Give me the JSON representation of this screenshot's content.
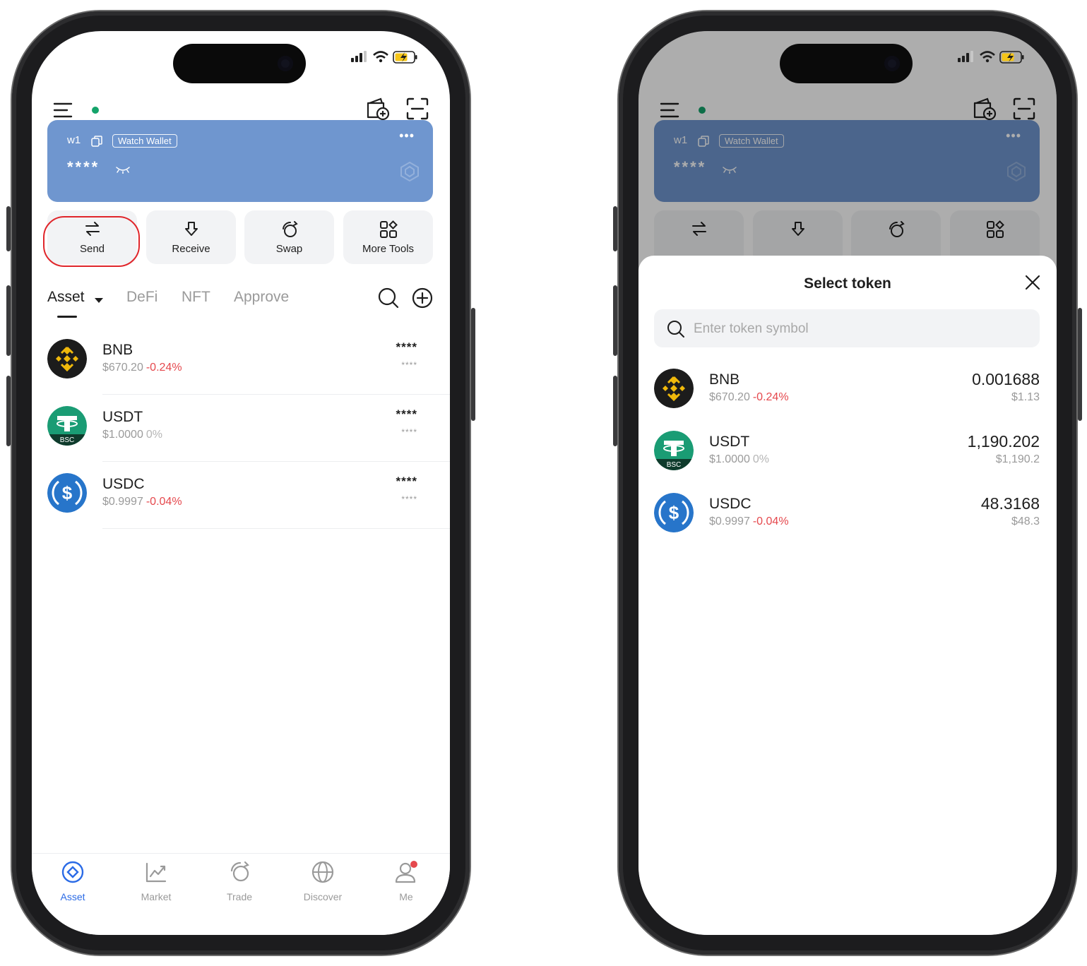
{
  "wallet": {
    "name": "w1",
    "badge": "Watch Wallet",
    "balance": "****",
    "more": "•••"
  },
  "actions": [
    "Send",
    "Receive",
    "Swap",
    "More Tools"
  ],
  "tabs": [
    "Asset",
    "DeFi",
    "NFT",
    "Approve"
  ],
  "assets": [
    {
      "symbol": "BNB",
      "price": "$670.20",
      "change": "-0.24%",
      "change_type": "neg",
      "hidden_amount": "****",
      "hidden_value": "****"
    },
    {
      "symbol": "USDT",
      "price": "$1.0000",
      "change": "0%",
      "change_type": "zero",
      "hidden_amount": "****",
      "hidden_value": "****",
      "chain_badge": "BSC"
    },
    {
      "symbol": "USDC",
      "price": "$0.9997",
      "change": "-0.04%",
      "change_type": "neg",
      "hidden_amount": "****",
      "hidden_value": "****"
    }
  ],
  "nav": [
    "Asset",
    "Market",
    "Trade",
    "Discover",
    "Me"
  ],
  "select_token": {
    "title": "Select token",
    "search_placeholder": "Enter token symbol",
    "tokens": [
      {
        "symbol": "BNB",
        "price": "$670.20",
        "change": "-0.24%",
        "amount": "0.001688",
        "usd": "$1.13"
      },
      {
        "symbol": "USDT",
        "price": "$1.0000",
        "change": "0%",
        "amount": "1,190.202",
        "usd": "$1,190.2",
        "chain_badge": "BSC"
      },
      {
        "symbol": "USDC",
        "price": "$0.9997",
        "change": "-0.04%",
        "amount": "48.3168",
        "usd": "$48.3"
      }
    ]
  },
  "colors": {
    "accent": "#2b6be6",
    "negative": "#e5484d",
    "card": "#6f96cf",
    "online": "#14a36a",
    "highlight": "#e0262b"
  }
}
